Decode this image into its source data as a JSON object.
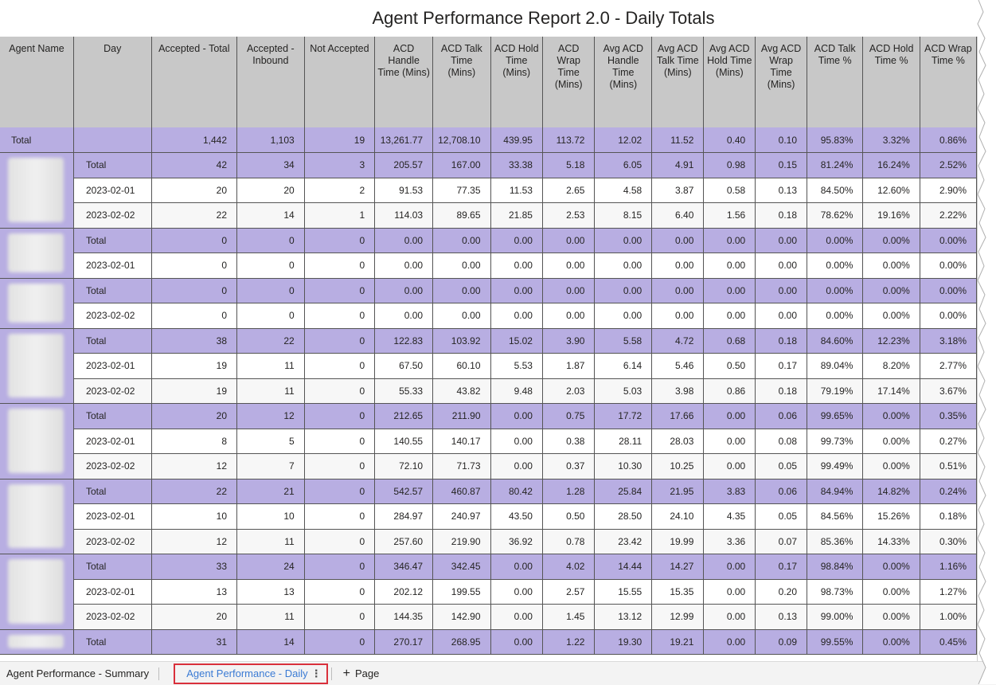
{
  "report": {
    "title": "Agent Performance Report 2.0 - Daily Totals",
    "columns": [
      "Agent Name",
      "Day",
      "Accepted - Total",
      "Accepted - Inbound",
      "Not Accepted",
      "ACD Handle Time (Mins)",
      "ACD Talk Time (Mins)",
      "ACD Hold Time (Mins)",
      "ACD Wrap Time (Mins)",
      "Avg ACD Handle Time (Mins)",
      "Avg ACD Talk Time (Mins)",
      "Avg ACD Hold Time (Mins)",
      "Avg ACD Wrap Time (Mins)",
      "ACD Talk Time %",
      "ACD Hold Time %",
      "ACD Wrap Time %"
    ],
    "grand_total": {
      "label": "Total",
      "values": [
        "1,442",
        "1,103",
        "19",
        "13,261.77",
        "12,708.10",
        "439.95",
        "113.72",
        "12.02",
        "11.52",
        "0.40",
        "0.10",
        "95.83%",
        "3.32%",
        "0.86%"
      ]
    },
    "agents": [
      {
        "rows": [
          {
            "day": "Total",
            "values": [
              "42",
              "34",
              "3",
              "205.57",
              "167.00",
              "33.38",
              "5.18",
              "6.05",
              "4.91",
              "0.98",
              "0.15",
              "81.24%",
              "16.24%",
              "2.52%"
            ]
          },
          {
            "day": "2023-02-01",
            "values": [
              "20",
              "20",
              "2",
              "91.53",
              "77.35",
              "11.53",
              "2.65",
              "4.58",
              "3.87",
              "0.58",
              "0.13",
              "84.50%",
              "12.60%",
              "2.90%"
            ]
          },
          {
            "day": "2023-02-02",
            "values": [
              "22",
              "14",
              "1",
              "114.03",
              "89.65",
              "21.85",
              "2.53",
              "8.15",
              "6.40",
              "1.56",
              "0.18",
              "78.62%",
              "19.16%",
              "2.22%"
            ]
          }
        ]
      },
      {
        "rows": [
          {
            "day": "Total",
            "values": [
              "0",
              "0",
              "0",
              "0.00",
              "0.00",
              "0.00",
              "0.00",
              "0.00",
              "0.00",
              "0.00",
              "0.00",
              "0.00%",
              "0.00%",
              "0.00%"
            ]
          },
          {
            "day": "2023-02-01",
            "values": [
              "0",
              "0",
              "0",
              "0.00",
              "0.00",
              "0.00",
              "0.00",
              "0.00",
              "0.00",
              "0.00",
              "0.00",
              "0.00%",
              "0.00%",
              "0.00%"
            ]
          }
        ]
      },
      {
        "rows": [
          {
            "day": "Total",
            "values": [
              "0",
              "0",
              "0",
              "0.00",
              "0.00",
              "0.00",
              "0.00",
              "0.00",
              "0.00",
              "0.00",
              "0.00",
              "0.00%",
              "0.00%",
              "0.00%"
            ]
          },
          {
            "day": "2023-02-02",
            "values": [
              "0",
              "0",
              "0",
              "0.00",
              "0.00",
              "0.00",
              "0.00",
              "0.00",
              "0.00",
              "0.00",
              "0.00",
              "0.00%",
              "0.00%",
              "0.00%"
            ]
          }
        ]
      },
      {
        "rows": [
          {
            "day": "Total",
            "values": [
              "38",
              "22",
              "0",
              "122.83",
              "103.92",
              "15.02",
              "3.90",
              "5.58",
              "4.72",
              "0.68",
              "0.18",
              "84.60%",
              "12.23%",
              "3.18%"
            ]
          },
          {
            "day": "2023-02-01",
            "values": [
              "19",
              "11",
              "0",
              "67.50",
              "60.10",
              "5.53",
              "1.87",
              "6.14",
              "5.46",
              "0.50",
              "0.17",
              "89.04%",
              "8.20%",
              "2.77%"
            ]
          },
          {
            "day": "2023-02-02",
            "values": [
              "19",
              "11",
              "0",
              "55.33",
              "43.82",
              "9.48",
              "2.03",
              "5.03",
              "3.98",
              "0.86",
              "0.18",
              "79.19%",
              "17.14%",
              "3.67%"
            ]
          }
        ]
      },
      {
        "rows": [
          {
            "day": "Total",
            "values": [
              "20",
              "12",
              "0",
              "212.65",
              "211.90",
              "0.00",
              "0.75",
              "17.72",
              "17.66",
              "0.00",
              "0.06",
              "99.65%",
              "0.00%",
              "0.35%"
            ]
          },
          {
            "day": "2023-02-01",
            "values": [
              "8",
              "5",
              "0",
              "140.55",
              "140.17",
              "0.00",
              "0.38",
              "28.11",
              "28.03",
              "0.00",
              "0.08",
              "99.73%",
              "0.00%",
              "0.27%"
            ]
          },
          {
            "day": "2023-02-02",
            "values": [
              "12",
              "7",
              "0",
              "72.10",
              "71.73",
              "0.00",
              "0.37",
              "10.30",
              "10.25",
              "0.00",
              "0.05",
              "99.49%",
              "0.00%",
              "0.51%"
            ]
          }
        ]
      },
      {
        "rows": [
          {
            "day": "Total",
            "values": [
              "22",
              "21",
              "0",
              "542.57",
              "460.87",
              "80.42",
              "1.28",
              "25.84",
              "21.95",
              "3.83",
              "0.06",
              "84.94%",
              "14.82%",
              "0.24%"
            ]
          },
          {
            "day": "2023-02-01",
            "values": [
              "10",
              "10",
              "0",
              "284.97",
              "240.97",
              "43.50",
              "0.50",
              "28.50",
              "24.10",
              "4.35",
              "0.05",
              "84.56%",
              "15.26%",
              "0.18%"
            ]
          },
          {
            "day": "2023-02-02",
            "values": [
              "12",
              "11",
              "0",
              "257.60",
              "219.90",
              "36.92",
              "0.78",
              "23.42",
              "19.99",
              "3.36",
              "0.07",
              "85.36%",
              "14.33%",
              "0.30%"
            ]
          }
        ]
      },
      {
        "rows": [
          {
            "day": "Total",
            "values": [
              "33",
              "24",
              "0",
              "346.47",
              "342.45",
              "0.00",
              "4.02",
              "14.44",
              "14.27",
              "0.00",
              "0.17",
              "98.84%",
              "0.00%",
              "1.16%"
            ]
          },
          {
            "day": "2023-02-01",
            "values": [
              "13",
              "13",
              "0",
              "202.12",
              "199.55",
              "0.00",
              "2.57",
              "15.55",
              "15.35",
              "0.00",
              "0.20",
              "98.73%",
              "0.00%",
              "1.27%"
            ]
          },
          {
            "day": "2023-02-02",
            "values": [
              "20",
              "11",
              "0",
              "144.35",
              "142.90",
              "0.00",
              "1.45",
              "13.12",
              "12.99",
              "0.00",
              "0.13",
              "99.00%",
              "0.00%",
              "1.00%"
            ]
          }
        ]
      },
      {
        "rows": [
          {
            "day": "Total",
            "values": [
              "31",
              "14",
              "0",
              "270.17",
              "268.95",
              "0.00",
              "1.22",
              "19.30",
              "19.21",
              "0.00",
              "0.09",
              "99.55%",
              "0.00%",
              "0.45%"
            ]
          }
        ]
      }
    ]
  },
  "footer": {
    "tabs": [
      {
        "label": "Agent Performance - Summary"
      },
      {
        "label": "Agent Performance - Daily"
      }
    ],
    "more_icon": "more-vertical-icon",
    "add_page_label": "Page",
    "add_icon": "plus-icon"
  },
  "colors": {
    "header_bg": "#c8c8c8",
    "total_row_bg": "#b8aee2",
    "active_tab_text": "#3b7bd4",
    "highlight_border": "#d9303b"
  }
}
